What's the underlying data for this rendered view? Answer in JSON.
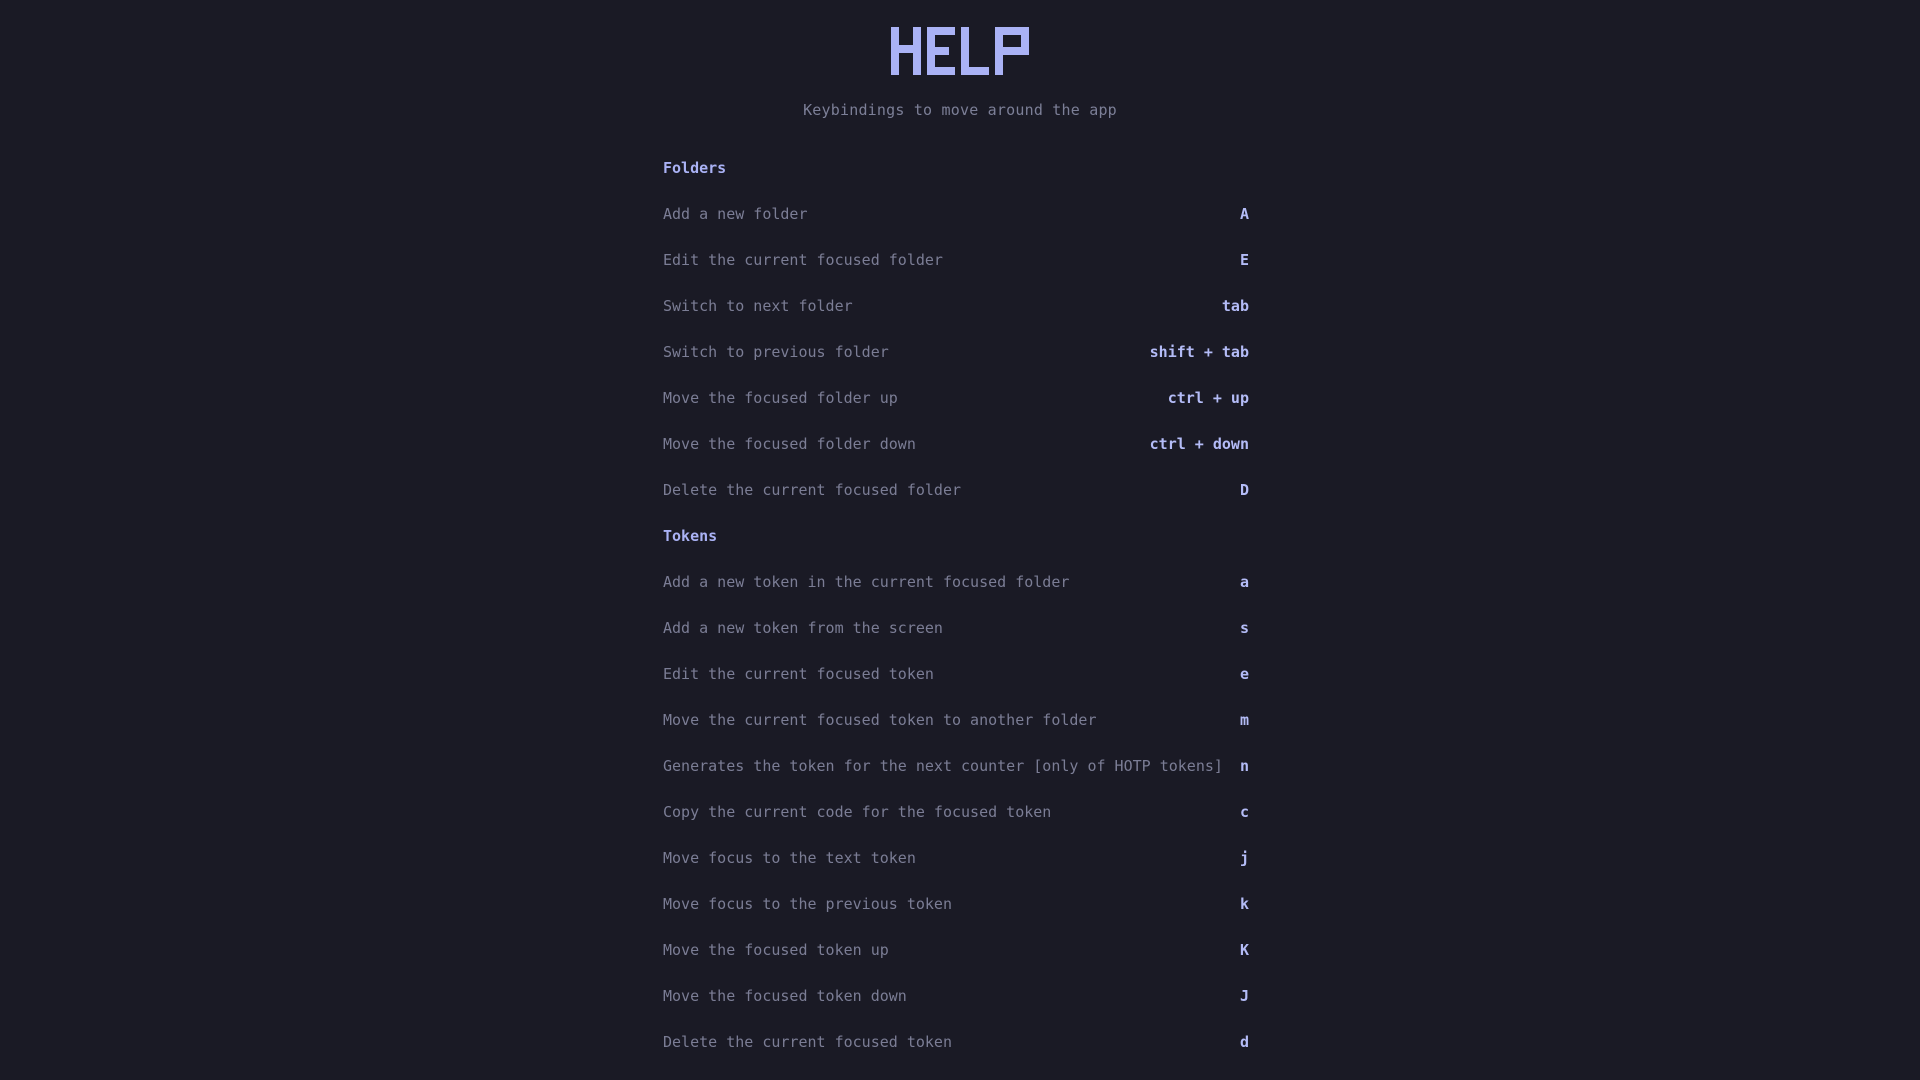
{
  "page": {
    "title": "HELP",
    "subtitle": "Keybindings to move around the app"
  },
  "colors": {
    "background": "#1a1a25",
    "accent": "#aab2f5",
    "key": "#b4bcf7",
    "text_muted": "#7b7d95"
  },
  "sections": [
    {
      "title": "Folders",
      "items": [
        {
          "desc": "Add a new folder",
          "key": "A"
        },
        {
          "desc": "Edit the current focused folder",
          "key": "E"
        },
        {
          "desc": "Switch to next folder",
          "key": "tab"
        },
        {
          "desc": "Switch to previous folder",
          "key": "shift + tab"
        },
        {
          "desc": "Move the focused folder up",
          "key": "ctrl + up"
        },
        {
          "desc": "Move the focused folder down",
          "key": "ctrl + down"
        },
        {
          "desc": "Delete the current focused folder",
          "key": "D"
        }
      ]
    },
    {
      "title": "Tokens",
      "items": [
        {
          "desc": "Add a new token in the current focused folder",
          "key": "a"
        },
        {
          "desc": "Add a new token from the screen",
          "key": "s"
        },
        {
          "desc": "Edit the current focused token",
          "key": "e"
        },
        {
          "desc": "Move the current focused token to another folder",
          "key": "m"
        },
        {
          "desc": "Generates the token for the next counter [only of HOTP tokens]",
          "key": "n"
        },
        {
          "desc": "Copy the current code for the focused token",
          "key": "c"
        },
        {
          "desc": "Move focus to the text token",
          "key": "j"
        },
        {
          "desc": "Move focus to the previous token",
          "key": "k"
        },
        {
          "desc": "Move the focused token up",
          "key": "K"
        },
        {
          "desc": "Move the focused token down",
          "key": "J"
        },
        {
          "desc": "Delete the current focused token",
          "key": "d"
        }
      ]
    }
  ]
}
